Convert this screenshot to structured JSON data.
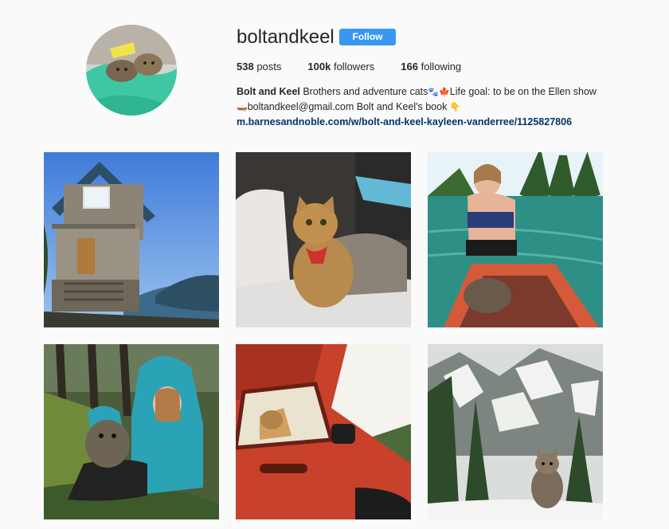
{
  "profile": {
    "username": "boltandkeel",
    "follow_label": "Follow",
    "stats": [
      {
        "count": "538",
        "label": "posts"
      },
      {
        "count": "100k",
        "label": "followers"
      },
      {
        "count": "166",
        "label": "following"
      }
    ],
    "bio": {
      "name": "Bolt and Keel",
      "text1": " Brothers and adventure cats",
      "text2": "Life goal: to be on the Ellen show",
      "text3": "boltandkeel@gmail.com Bolt and Keel's book ",
      "link": "m.barnesandnoble.com/w/bolt-and-keel-kayleen-vanderree/1125827806"
    }
  },
  "posts": [
    {
      "icon": "cabin-photo"
    },
    {
      "icon": "cat-on-pillow-photo"
    },
    {
      "icon": "woman-canoe-photo"
    },
    {
      "icon": "hooded-woman-cat-photo"
    },
    {
      "icon": "red-car-cat-photo"
    },
    {
      "icon": "snowy-mountain-cat-photo"
    }
  ],
  "colors": {
    "follow_button": "#3897f0",
    "link": "#003569",
    "background": "#fafafa"
  }
}
